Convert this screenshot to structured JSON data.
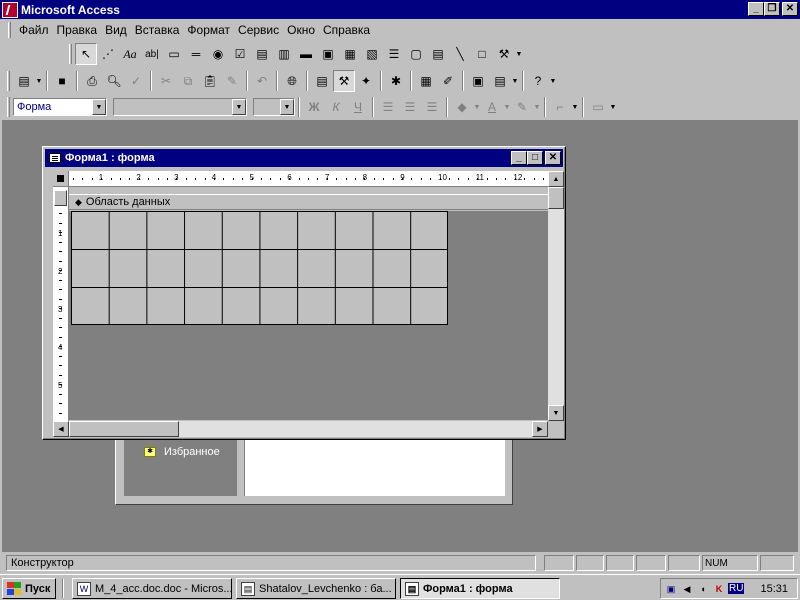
{
  "app": {
    "title": "Microsoft Access"
  },
  "menu": [
    "Файл",
    "Правка",
    "Вид",
    "Вставка",
    "Формат",
    "Сервис",
    "Окно",
    "Справка"
  ],
  "toolbox": {
    "icons": [
      "select-objects-icon",
      "control-wizards-icon",
      "label-icon",
      "textbox-icon",
      "option-group-icon",
      "toggle-button-icon",
      "option-button-icon",
      "checkbox-icon",
      "combobox-icon",
      "listbox-icon",
      "command-button-icon",
      "image-icon",
      "unbound-object-icon",
      "bound-object-icon",
      "page-break-icon",
      "tab-control-icon",
      "subform-icon",
      "line-icon",
      "rectangle-icon",
      "more-controls-icon"
    ],
    "text_glyphs": {
      "label": "Aa",
      "textbox": "ab|"
    }
  },
  "format_bar": {
    "object_combo": "Форма",
    "font_combo": "",
    "size_combo": "",
    "bold": "Ж",
    "italic": "К",
    "underline": "Ч"
  },
  "form_window": {
    "title": "Форма1 : форма",
    "section": "Область данных",
    "ruler_h": [
      "1",
      "2",
      "3",
      "4",
      "5",
      "6",
      "7",
      "8",
      "9",
      "10",
      "11",
      "12"
    ],
    "ruler_v": [
      "1",
      "2",
      "3",
      "4",
      "5"
    ]
  },
  "db_window": {
    "favorites": "Избранное"
  },
  "status": {
    "message": "Конструктор",
    "num": "NUM"
  },
  "taskbar": {
    "start": "Пуск",
    "tasks": [
      "M_4_acc.doc.doc - Micros...",
      "Shatalov_Levchenko : ба...",
      "Форма1 : форма"
    ],
    "lang": "RU",
    "clock": "15:31"
  },
  "colors": {
    "title_bar": "#000080",
    "desktop": "#808080",
    "face": "#c0c0c0"
  }
}
